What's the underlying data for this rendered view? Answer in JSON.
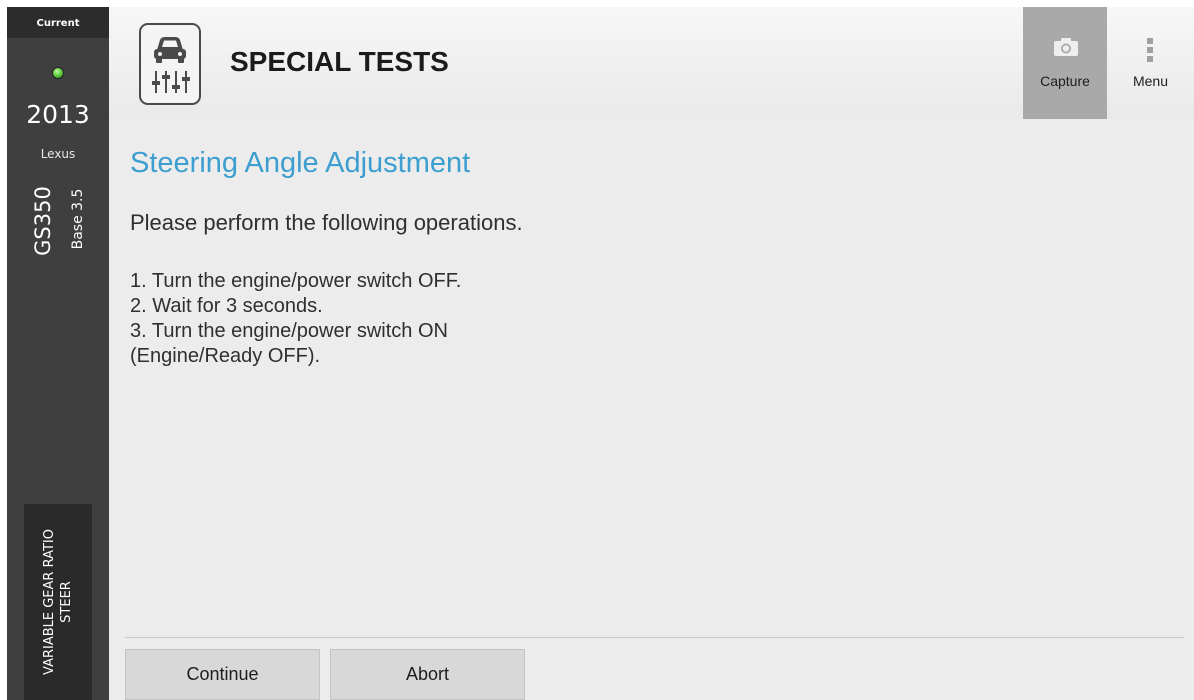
{
  "sidebar": {
    "current_label": "Current",
    "status_color": "#5fd23d",
    "vehicle": {
      "year": "2013",
      "make": "Lexus",
      "model": "GS350",
      "trim": "Base 3.5"
    },
    "system": {
      "line1": "VARIABLE GEAR RATIO",
      "line2": "STEER"
    }
  },
  "header": {
    "title": "SPECIAL TESTS",
    "icon": "car-diagnostic-sliders-icon",
    "actions": {
      "capture_label": "Capture",
      "capture_icon": "camera-icon",
      "menu_label": "Menu",
      "menu_icon": "vertical-dots-icon"
    }
  },
  "content": {
    "title": "Steering Angle Adjustment",
    "intro": "Please perform the following operations.",
    "steps": [
      "1. Turn the engine/power switch OFF.",
      "2. Wait for 3 seconds.",
      "3. Turn the engine/power switch ON",
      "(Engine/Ready OFF)."
    ]
  },
  "footer": {
    "continue_label": "Continue",
    "abort_label": "Abort"
  },
  "colors": {
    "accent": "#3d9ed0",
    "sidebar_bg": "#3f3f3f",
    "capture_bg": "#a9a9a9"
  }
}
